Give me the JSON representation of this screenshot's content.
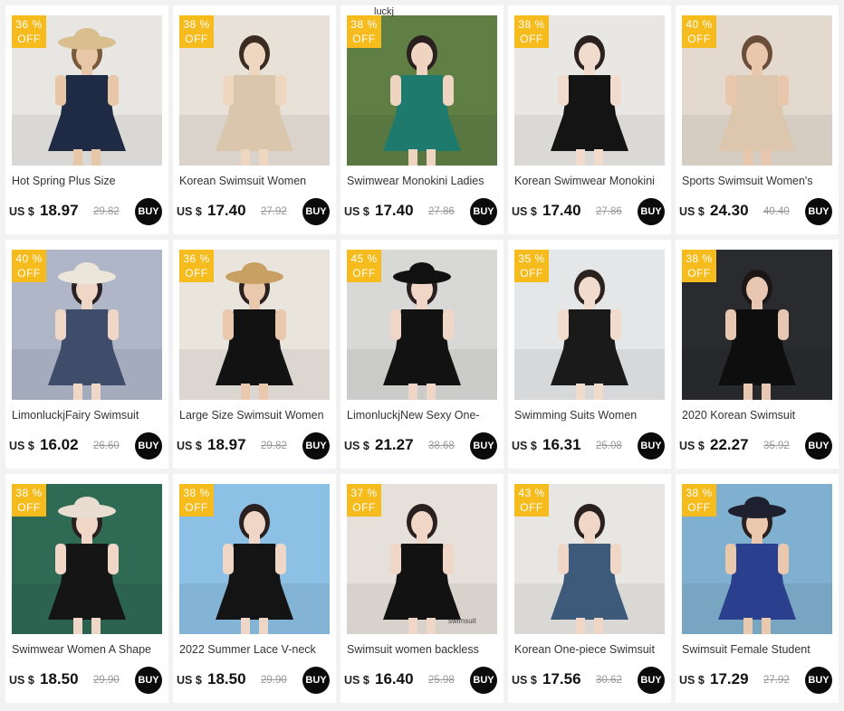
{
  "products": [
    {
      "badge": [
        "36 %",
        "OFF"
      ],
      "title": "Hot Spring Plus Size",
      "currency": "US $",
      "price": "18.97",
      "old_price": "29.82",
      "buy": "BUY",
      "bg": "#e8e6e2",
      "dress": "#1f2a44",
      "skin": "#e8c6a8",
      "hair": "#7a5a3a",
      "hat": "#d9bf8f"
    },
    {
      "badge": [
        "38 %",
        "OFF"
      ],
      "title": "Korean Swimsuit Women",
      "currency": "US $",
      "price": "17.40",
      "old_price": "27.92",
      "buy": "BUY",
      "bg": "#e7e1d8",
      "dress": "#d9c6ac",
      "skin": "#efd6c0",
      "hair": "#3b2c22",
      "hat": ""
    },
    {
      "badge": [
        "38 %",
        "OFF"
      ],
      "title": "Swimwear Monokini Ladies",
      "currency": "US $",
      "price": "17.40",
      "old_price": "27.86",
      "buy": "BUY",
      "bg": "#5f7f45",
      "dress": "#1f7a6e",
      "skin": "#efd4c2",
      "hair": "#2a2020",
      "hat": "",
      "watermark": "luckj"
    },
    {
      "badge": [
        "38 %",
        "OFF"
      ],
      "title": "Korean Swimwear Monokini",
      "currency": "US $",
      "price": "17.40",
      "old_price": "27.86",
      "buy": "BUY",
      "bg": "#e9e7e3",
      "dress": "#141414",
      "skin": "#f1dbcc",
      "hair": "#2b2220",
      "hat": ""
    },
    {
      "badge": [
        "40 %",
        "OFF"
      ],
      "title": "Sports Swimsuit Women's",
      "currency": "US $",
      "price": "24.30",
      "old_price": "40.40",
      "buy": "BUY",
      "bg": "#e3d9cf",
      "dress": "#dcc6ae",
      "skin": "#e8c7ad",
      "hair": "#6b4e3a",
      "hat": ""
    },
    {
      "badge": [
        "40 %",
        "OFF"
      ],
      "title": "LimonluckjFairy Swimsuit",
      "currency": "US $",
      "price": "16.02",
      "old_price": "26.60",
      "buy": "BUY",
      "bg": "#aeb6c8",
      "dress": "#3f4d6b",
      "skin": "#efd6c6",
      "hair": "#2a2222",
      "hat": "#ece5da"
    },
    {
      "badge": [
        "36 %",
        "OFF"
      ],
      "title": "Large Size Swimsuit Women",
      "currency": "US $",
      "price": "18.97",
      "old_price": "29.82",
      "buy": "BUY",
      "bg": "#e9e4dc",
      "dress": "#121212",
      "skin": "#e9c8ae",
      "hair": "#2a2020",
      "hat": "#c9a063"
    },
    {
      "badge": [
        "45 %",
        "OFF"
      ],
      "title": "LimonluckjNew Sexy One-",
      "currency": "US $",
      "price": "21.27",
      "old_price": "38.68",
      "buy": "BUY",
      "bg": "#d8d8d6",
      "dress": "#121212",
      "skin": "#efd6c6",
      "hair": "#2a2020",
      "hat": "#111111"
    },
    {
      "badge": [
        "35 %",
        "OFF"
      ],
      "title": "Swimming Suits Women",
      "currency": "US $",
      "price": "16.31",
      "old_price": "25.08",
      "buy": "BUY",
      "bg": "#e5e6e8",
      "dress": "#1a1a1a",
      "skin": "#f1dbcc",
      "hair": "#2b2220",
      "hat": ""
    },
    {
      "badge": [
        "38 %",
        "OFF"
      ],
      "title": "2020 Korean Swimsuit",
      "currency": "US $",
      "price": "22.27",
      "old_price": "35.92",
      "buy": "BUY",
      "bg": "#2a2b2e",
      "dress": "#0e0e0e",
      "skin": "#e7c7b1",
      "hair": "#1c1616",
      "hat": ""
    },
    {
      "badge": [
        "38 %",
        "OFF"
      ],
      "title": "Swimwear Women A Shape",
      "currency": "US $",
      "price": "18.50",
      "old_price": "29.90",
      "buy": "BUY",
      "bg": "#2f6a55",
      "dress": "#151515",
      "skin": "#efd6c6",
      "hair": "#2a2020",
      "hat": "#e8ddd0"
    },
    {
      "badge": [
        "38 %",
        "OFF"
      ],
      "title": "2022 Summer Lace V-neck",
      "currency": "US $",
      "price": "18.50",
      "old_price": "29.90",
      "buy": "BUY",
      "bg": "#8cc0e4",
      "dress": "#141414",
      "skin": "#efd6c6",
      "hair": "#2a2020",
      "hat": ""
    },
    {
      "badge": [
        "37 %",
        "OFF"
      ],
      "title": "Swimsuit women backless",
      "currency": "US $",
      "price": "16.40",
      "old_price": "25.98",
      "buy": "BUY",
      "bg": "#e6e0da",
      "dress": "#121212",
      "skin": "#efd6c6",
      "hair": "#2a2020",
      "hat": "",
      "tag": "swimsuit"
    },
    {
      "badge": [
        "43 %",
        "OFF"
      ],
      "title": "Korean One-piece Swimsuit",
      "currency": "US $",
      "price": "17.56",
      "old_price": "30.62",
      "buy": "BUY",
      "bg": "#e8e6e2",
      "dress": "#3e5a7a",
      "skin": "#efd6c6",
      "hair": "#2a2020",
      "hat": ""
    },
    {
      "badge": [
        "38 %",
        "OFF"
      ],
      "title": "Swimsuit Female Student",
      "currency": "US $",
      "price": "17.29",
      "old_price": "27.92",
      "buy": "BUY",
      "bg": "#7fb0cf",
      "dress": "#2a3f8e",
      "skin": "#e9c8ae",
      "hair": "#2a2020",
      "hat": "#1e2030"
    }
  ]
}
